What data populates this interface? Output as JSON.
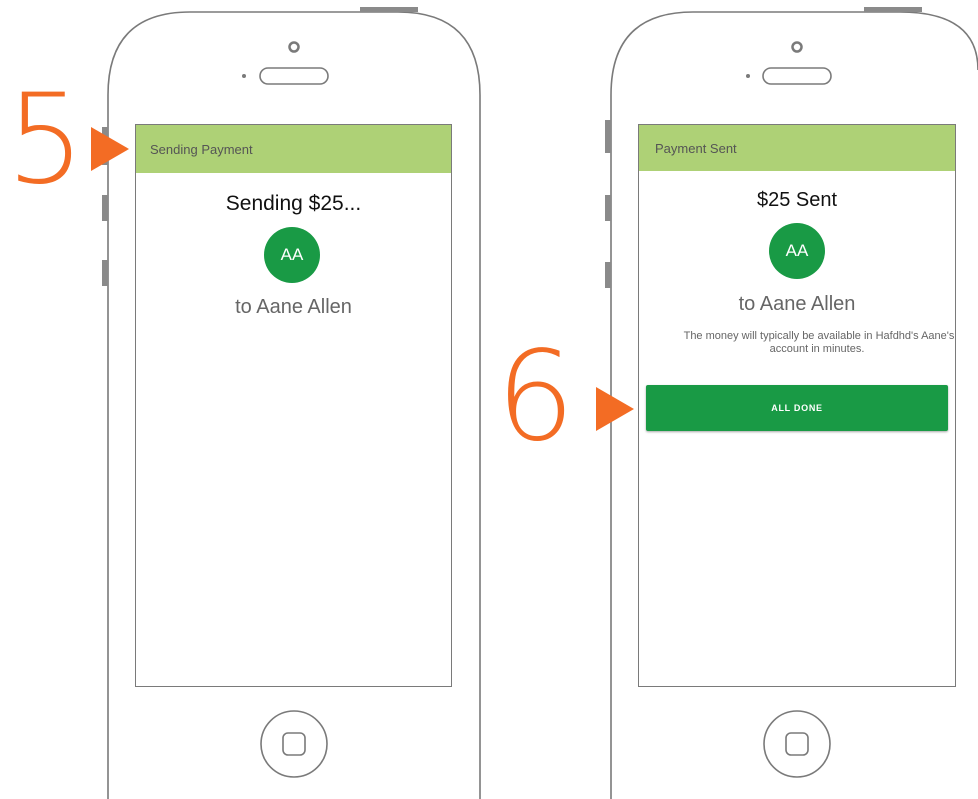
{
  "colors": {
    "header_bg": "#aed176",
    "accent_green": "#199a45",
    "step_orange": "#f36c24",
    "outline_gray": "#7a7a7a"
  },
  "steps": [
    {
      "number": "5",
      "arrow_icon": "triangle-right-icon"
    },
    {
      "number": "6",
      "arrow_icon": "triangle-right-icon"
    }
  ],
  "screens": [
    {
      "header_title": "Sending Payment",
      "title": "Sending $25...",
      "avatar_initials": "AA",
      "recipient": "to Aane Allen"
    },
    {
      "header_title": "Payment Sent",
      "title": "$25 Sent",
      "avatar_initials": "AA",
      "recipient": "to Aane Allen",
      "note_line1": "The money will typically be available in Hafdhd's  Aane's",
      "note_line2": "account in minutes.",
      "done_button": "ALL DONE"
    }
  ]
}
